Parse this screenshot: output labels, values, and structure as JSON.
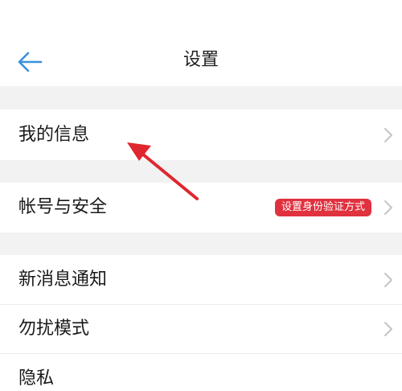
{
  "header": {
    "title": "设置",
    "back_icon": "arrow-left-icon"
  },
  "rows": [
    {
      "label": "我的信息",
      "icon": "chevron-right-icon"
    },
    {
      "label": "帐号与安全",
      "badge": "设置身份验证方式",
      "icon": "chevron-right-icon"
    },
    {
      "label": "新消息通知",
      "icon": "chevron-right-icon"
    },
    {
      "label": "勿扰模式",
      "icon": "chevron-right-icon"
    },
    {
      "label": "隐私"
    }
  ],
  "colors": {
    "accent_blue": "#3a8fdd",
    "badge_red": "#e0313e",
    "annotation_arrow_red": "#e0262f",
    "section_gap": "#f2f2f2"
  }
}
